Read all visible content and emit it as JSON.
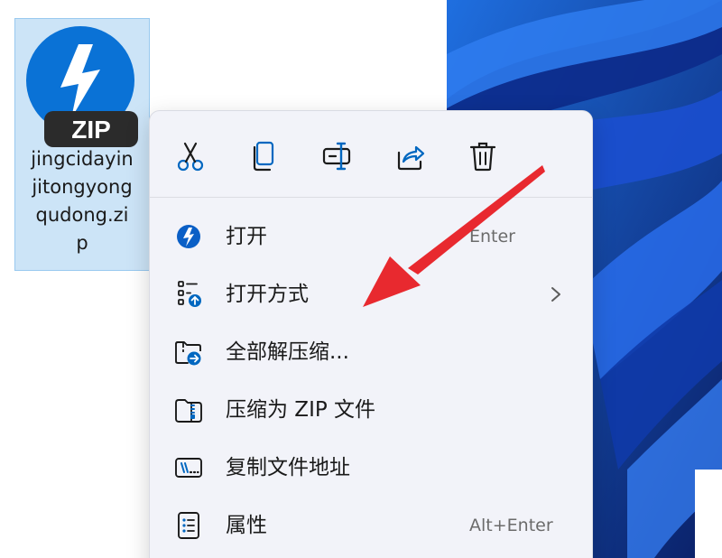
{
  "file": {
    "badge": "ZIP",
    "name_lines": [
      "jingcidayin",
      "jitongyong",
      "qudong.zi",
      "p"
    ]
  },
  "context_menu": {
    "toolbar": [
      {
        "icon": "cut-icon"
      },
      {
        "icon": "copy-icon"
      },
      {
        "icon": "rename-icon"
      },
      {
        "icon": "share-icon"
      },
      {
        "icon": "delete-icon"
      }
    ],
    "items": [
      {
        "label": "打开",
        "shortcut": "Enter",
        "icon": "open-app-icon"
      },
      {
        "label": "打开方式",
        "shortcut": "",
        "icon": "open-with-icon",
        "has_submenu": true
      },
      {
        "label": "全部解压缩...",
        "shortcut": "",
        "icon": "extract-all-icon"
      },
      {
        "label": "压缩为 ZIP 文件",
        "shortcut": "",
        "icon": "compress-zip-icon"
      },
      {
        "label": "复制文件地址",
        "shortcut": "",
        "icon": "copy-path-icon"
      },
      {
        "label": "属性",
        "shortcut": "Alt+Enter",
        "icon": "properties-icon"
      }
    ]
  },
  "colors": {
    "accent": "#0067c0",
    "selection": "#cce4f7",
    "annotation": "#e8292f",
    "wallpaper": "#0a2a7a"
  }
}
